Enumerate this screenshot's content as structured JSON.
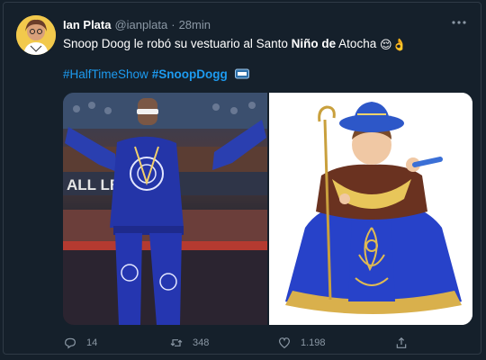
{
  "tweet": {
    "author_name": "Ian Plata",
    "handle": "@ianplata",
    "separator": "·",
    "time": "28min",
    "text_before": "Snoop Doog le robó su vestuario al Santo ",
    "text_bold": "Niño de",
    "text_after": " Atocha",
    "emojis": [
      "😌",
      "👌"
    ],
    "hashtags": [
      {
        "label": "#HalfTimeShow",
        "bold": false
      },
      {
        "label": "#SnoopDogg",
        "bold": true
      }
    ],
    "more_icon": "more-horizontal-icon"
  },
  "media": {
    "left": {
      "subject": "Snoop Dogg performing in blue bandana outfit",
      "banner_text": "ALL LEAGUE"
    },
    "right": {
      "subject": "Santo Niño de Atocha figure in blue and gold robe"
    }
  },
  "actions": {
    "reply_count": "14",
    "retweet_count": "348",
    "like_count": "1.198",
    "icons": [
      "reply-icon",
      "retweet-icon",
      "like-icon",
      "share-icon"
    ]
  },
  "colors": {
    "background": "#15202b",
    "accent": "#1d9bf0",
    "muted": "#8b98a5"
  }
}
